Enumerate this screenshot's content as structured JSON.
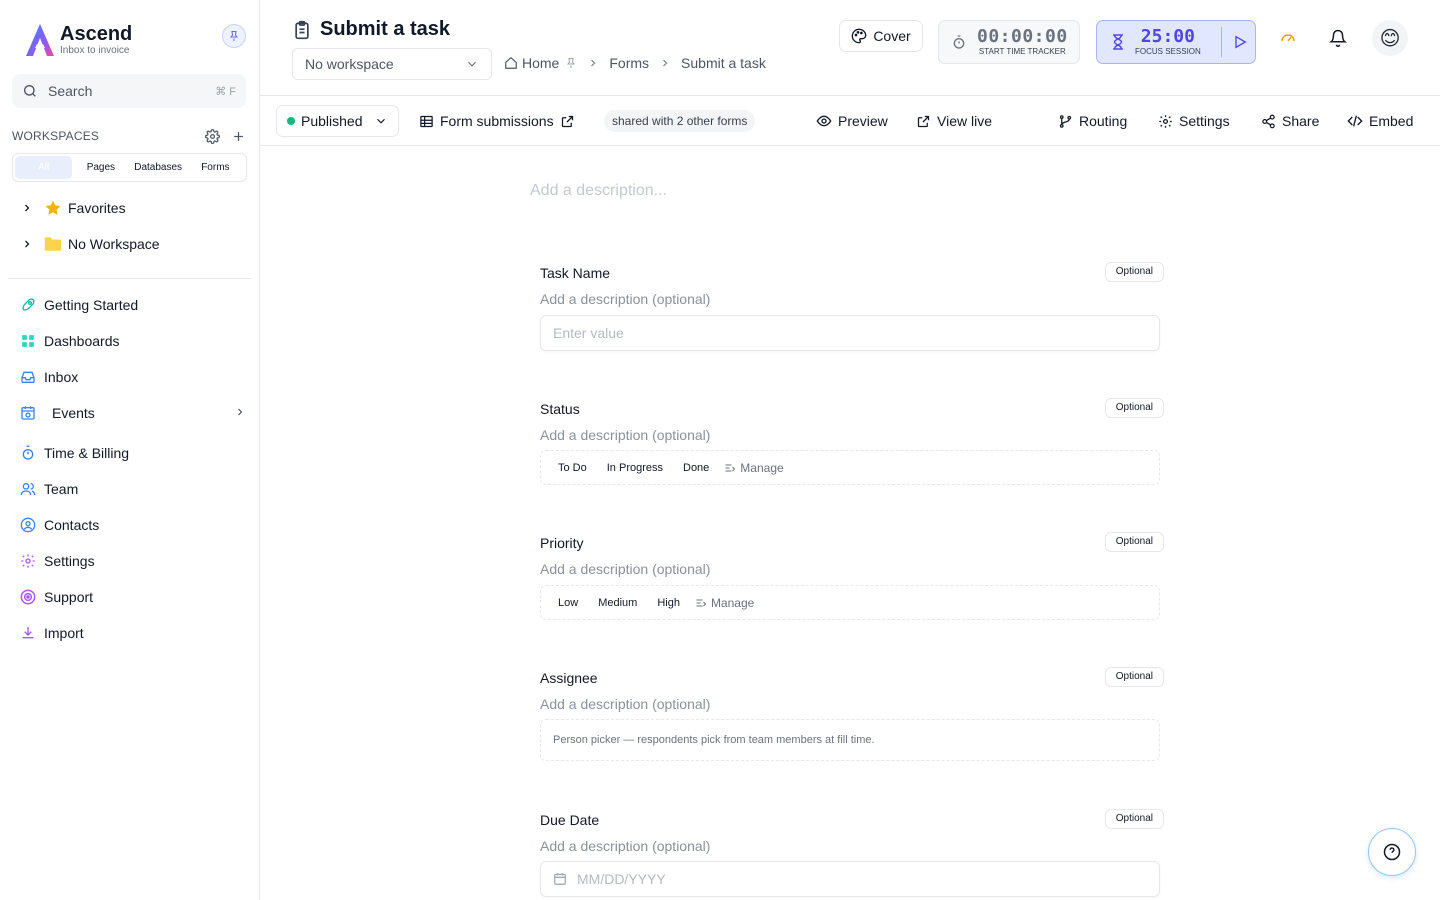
{
  "app": {
    "name": "Ascend",
    "tagline": "Inbox to invoice"
  },
  "sidebar": {
    "search_label": "Search",
    "search_shortcut": "⌘ F",
    "workspaces_title": "WORKSPACES",
    "filter_tabs": [
      "All",
      "Pages",
      "Databases",
      "Forms"
    ],
    "tree": [
      {
        "label": "Favorites",
        "icon": "star-icon"
      },
      {
        "label": "No Workspace",
        "icon": "folder-icon"
      }
    ],
    "nav": [
      {
        "label": "Getting Started",
        "icon": "rocket-icon"
      },
      {
        "label": "Dashboards",
        "icon": "grid-icon"
      },
      {
        "label": "Inbox",
        "icon": "inbox-icon"
      },
      {
        "label": "Events",
        "icon": "calendar-clock-icon"
      },
      {
        "label": "Time & Billing",
        "icon": "timer-icon"
      },
      {
        "label": "Team",
        "icon": "users-icon"
      },
      {
        "label": "Contacts",
        "icon": "contact-icon"
      },
      {
        "label": "Settings",
        "icon": "gear-icon"
      },
      {
        "label": "Support",
        "icon": "lifebuoy-icon"
      },
      {
        "label": "Import",
        "icon": "download-icon"
      }
    ]
  },
  "header": {
    "title": "Submit a task",
    "workspace_select": "No workspace",
    "breadcrumb": [
      "Home",
      "Forms",
      "Submit a task"
    ],
    "cover_label": "Cover",
    "tracker": {
      "time": "00:00:00",
      "label": "START TIME TRACKER"
    },
    "focus": {
      "time": "25:00",
      "label": "FOCUS SESSION"
    }
  },
  "toolbar": {
    "status": "Published",
    "submissions": "Form submissions",
    "shared": "shared with 2 other forms",
    "preview": "Preview",
    "view_live": "View live",
    "routing": "Routing",
    "settings": "Settings",
    "share": "Share",
    "embed": "Embed"
  },
  "form": {
    "description_placeholder": "Add a description...",
    "fields": [
      {
        "label": "Task Name",
        "badge": "Optional",
        "sub": "Add a description (optional)",
        "placeholder": "Enter value"
      },
      {
        "label": "Status",
        "badge": "Optional",
        "sub": "Add a description (optional)",
        "options": [
          "To Do",
          "In Progress",
          "Done"
        ],
        "manage": "Manage"
      },
      {
        "label": "Priority",
        "badge": "Optional",
        "sub": "Add a description (optional)",
        "options": [
          "Low",
          "Medium",
          "High"
        ],
        "manage": "Manage"
      },
      {
        "label": "Assignee",
        "badge": "Optional",
        "sub": "Add a description (optional)",
        "note": "Person picker — respondents pick from team members at fill time."
      },
      {
        "label": "Due Date",
        "badge": "Optional",
        "sub": "Add a description (optional)",
        "placeholder": "MM/DD/YYYY"
      }
    ]
  },
  "colors": {
    "accent": "#4f46e5",
    "published": "#10b981"
  }
}
